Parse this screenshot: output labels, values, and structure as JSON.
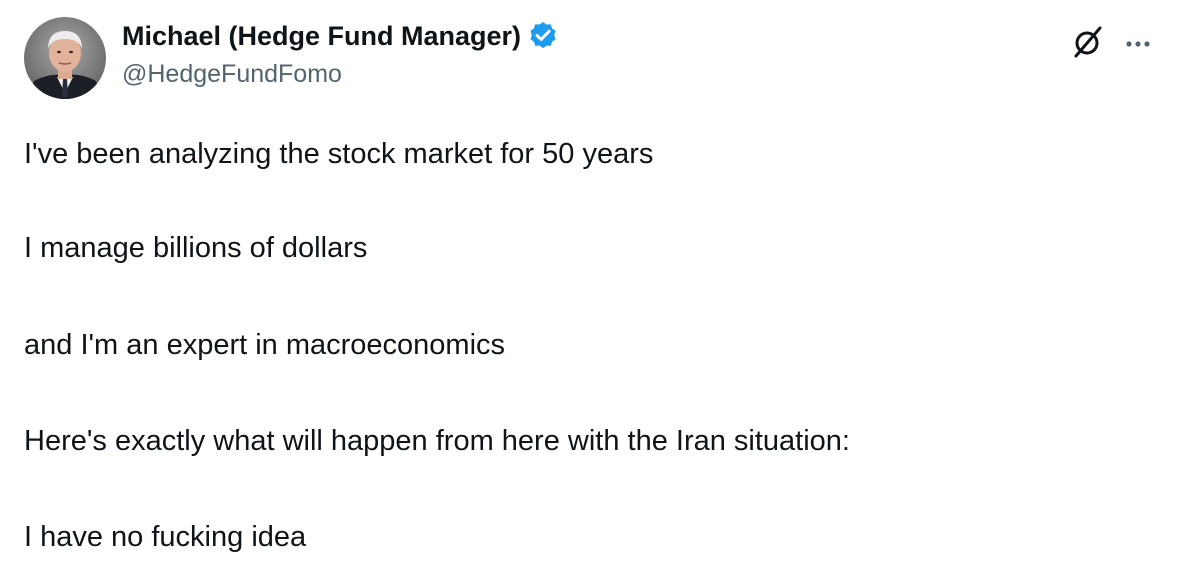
{
  "author": {
    "display_name": "Michael (Hedge Fund Manager)",
    "handle": "@HedgeFundFomo",
    "verified": true,
    "verified_color": "#1d9bf0",
    "avatar_icon": "profile-photo"
  },
  "actions": {
    "grok_icon": "grok-icon",
    "more_icon": "more-horizontal-icon"
  },
  "tweet": {
    "lines": [
      "I've been analyzing the stock market for 50 years",
      "I manage billions of dollars",
      "and I'm an expert in macroeconomics",
      "Here's exactly what will happen from here with the Iran situation:",
      "I have no fucking idea"
    ]
  },
  "colors": {
    "text_primary": "#0f1419",
    "text_secondary": "#536471",
    "background": "#ffffff"
  }
}
